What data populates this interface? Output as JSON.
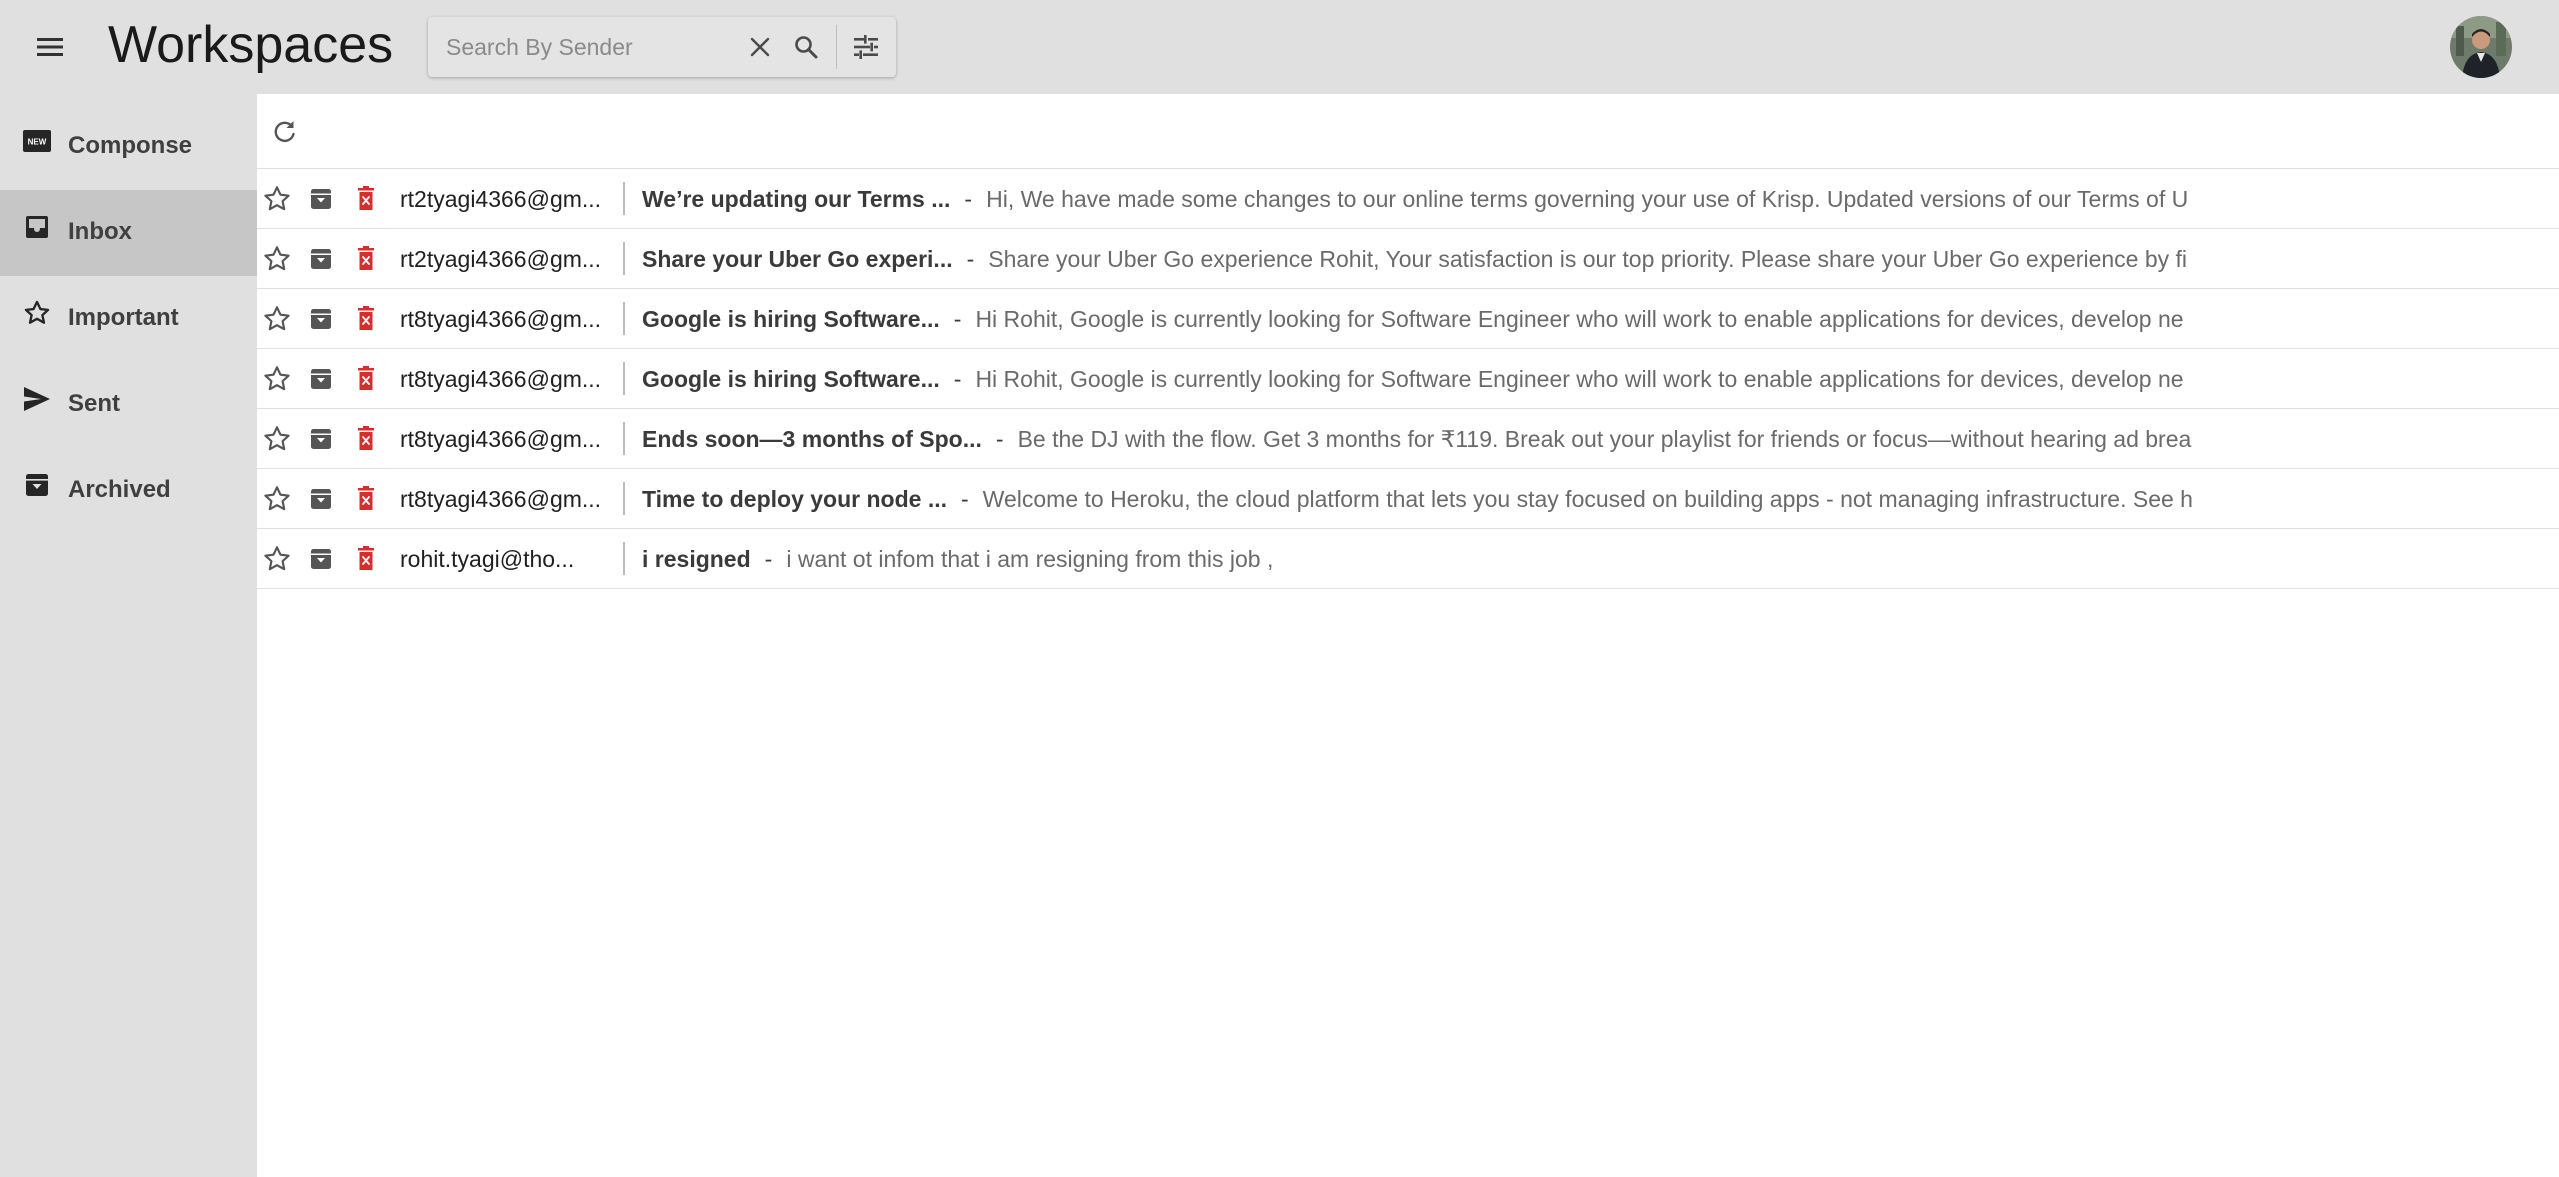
{
  "header": {
    "title": "Workspaces",
    "menu_icon": "hamburger-menu-icon",
    "search": {
      "placeholder": "Search By Sender",
      "value": "",
      "clear_icon": "close-icon",
      "search_icon": "search-icon",
      "filter_icon": "tune-icon"
    },
    "avatar_icon": "user-avatar"
  },
  "sidebar": {
    "items": [
      {
        "label": "Componse",
        "icon": "new-badge-icon",
        "active": false
      },
      {
        "label": "Inbox",
        "icon": "inbox-icon",
        "active": true
      },
      {
        "label": "Important",
        "icon": "star-outline-icon",
        "active": false
      },
      {
        "label": "Sent",
        "icon": "send-icon",
        "active": false
      },
      {
        "label": "Archived",
        "icon": "archive-icon",
        "active": false
      }
    ]
  },
  "toolbar": {
    "refresh_icon": "refresh-icon"
  },
  "emails": [
    {
      "sender": "rt2tyagi4366@gm...",
      "subject": "We’re updating our Terms ...",
      "separator": "-",
      "snippet": "Hi, We have made some changes to our online terms governing your use of Krisp. Updated versions of our Terms of U"
    },
    {
      "sender": "rt2tyagi4366@gm...",
      "subject": "Share your Uber Go experi...",
      "separator": "-",
      "snippet": "Share your Uber Go experience Rohit, Your satisfaction is our top priority. Please share your Uber Go experience by fi"
    },
    {
      "sender": "rt8tyagi4366@gm...",
      "subject": "Google is hiring Software...",
      "separator": "-",
      "snippet": "Hi Rohit, Google is currently looking for Software Engineer who will work to enable applications for devices, develop ne"
    },
    {
      "sender": "rt8tyagi4366@gm...",
      "subject": "Google is hiring Software...",
      "separator": "-",
      "snippet": "Hi Rohit, Google is currently looking for Software Engineer who will work to enable applications for devices, develop ne"
    },
    {
      "sender": "rt8tyagi4366@gm...",
      "subject": "Ends soon—3 months of Spo...",
      "separator": "-",
      "snippet": "Be the DJ with the flow. Get 3 months for ₹119. Break out your playlist for friends or focus—without hearing ad brea"
    },
    {
      "sender": "rt8tyagi4366@gm...",
      "subject": "Time to deploy your node ...",
      "separator": "-",
      "snippet": "Welcome to Heroku, the cloud platform that lets you stay focused on building apps - not managing infrastructure. See h"
    },
    {
      "sender": "rohit.tyagi@tho...",
      "subject": "i resigned",
      "separator": "-",
      "snippet": "i want ot infom that i am resigning from this job ,"
    }
  ],
  "colors": {
    "chrome_bg": "#e0e0e0",
    "active_nav": "#c6c6c6",
    "delete_red": "#d32f2f",
    "icon_gray": "#555555"
  }
}
